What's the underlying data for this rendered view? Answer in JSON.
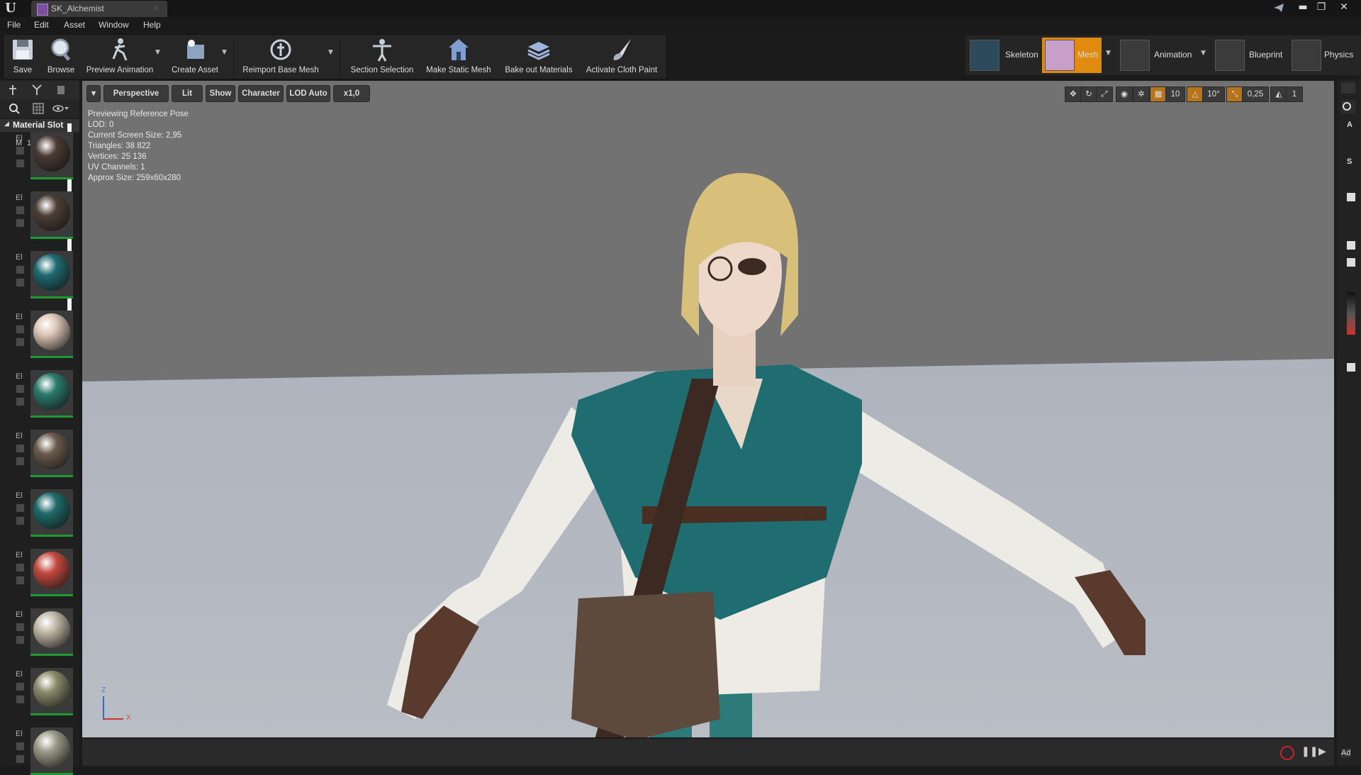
{
  "window": {
    "logo": "U",
    "tab_title": "SK_Alchemist",
    "tab_close": "×",
    "minimize": "▬",
    "maximize": "❐",
    "close": "✕"
  },
  "menu": [
    "File",
    "Edit",
    "Asset",
    "Window",
    "Help"
  ],
  "toolbar": {
    "save": "Save",
    "browse": "Browse",
    "preview_animation": "Preview Animation",
    "create_asset": "Create Asset",
    "reimport": "Reimport Base Mesh",
    "section_selection": "Section Selection",
    "make_static_mesh": "Make Static Mesh",
    "bake_out": "Bake out Materials",
    "cloth_paint": "Activate Cloth Paint"
  },
  "modes": {
    "skeleton": "Skeleton",
    "mesh": "Mesh",
    "animation": "Animation",
    "blueprint": "Blueprint",
    "physics": "Physics"
  },
  "left_panel": {
    "title": "Material Slot",
    "m": "M",
    "count": "11 M",
    "add": "+",
    "element_label": "El"
  },
  "viewport": {
    "perspective": "Perspective",
    "lit": "Lit",
    "show": "Show",
    "character": "Character",
    "lod": "LOD Auto",
    "speed": "x1,0",
    "grid_snap": "10",
    "rot_snap": "10°",
    "scale_snap": "0,25",
    "cam_speed": "1",
    "stats": [
      "Previewing Reference Pose",
      "LOD: 0",
      "Current Screen Size: 2,95",
      "Triangles: 38 822",
      "Vertices: 25 136",
      "UV Channels: 1",
      "Approx Size: 259x60x280"
    ],
    "axis_z": "Z",
    "axis_x": "X"
  },
  "right_panel": {
    "a": "A",
    "s": "S",
    "ad": "Ad"
  },
  "colors": {
    "accent": "#e08a10",
    "thumb_border": "#1f9a33"
  }
}
